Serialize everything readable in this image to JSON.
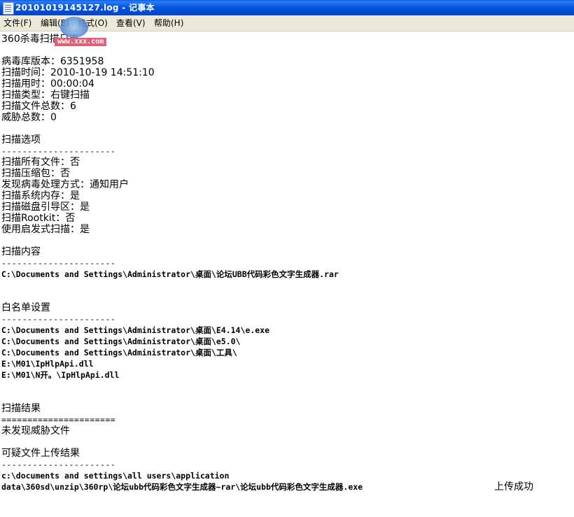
{
  "window": {
    "title": "20101019145127.log - 记事本",
    "icon": "notepad-icon"
  },
  "menu": [
    {
      "label": "文件(F)"
    },
    {
      "label": "编辑(E)"
    },
    {
      "label": "格式(O)"
    },
    {
      "label": "查看(V)"
    },
    {
      "label": "帮助(H)"
    }
  ],
  "watermark": {
    "text": "www.xxx.com"
  },
  "log": {
    "header": "360杀毒扫描日志",
    "summary": [
      "病毒库版本：6351958",
      "扫描时间：2010-10-19 14:51:10",
      "扫描用时：00:00:04",
      "扫描类型：右键扫描",
      "扫描文件总数：6",
      "威胁总数：0"
    ],
    "options_heading": "扫描选项",
    "dash_line": "----------------------",
    "options": [
      "扫描所有文件：否",
      "扫描压缩包：否",
      "发现病毒处理方式：通知用户",
      "扫描系统内存：是",
      "扫描磁盘引导区：是",
      "扫描Rootkit：否",
      "使用启发式扫描：是"
    ],
    "content_heading": "扫描内容",
    "content": [
      "C:\\Documents and Settings\\Administrator\\桌面\\论坛UBB代码彩色文字生成器.rar"
    ],
    "whitelist_heading": "白名单设置",
    "whitelist": [
      "C:\\Documents and Settings\\Administrator\\桌面\\E4.14\\e.exe",
      "C:\\Documents and Settings\\Administrator\\桌面\\e5.0\\",
      "C:\\Documents and Settings\\Administrator\\桌面\\工具\\",
      "E:\\M01\\IpHlpApi.dll",
      "E:\\M01\\N开。\\IpHlpApi.dll"
    ],
    "result_heading": "扫描结果",
    "eq_line": "======================",
    "result": "未发现威胁文件",
    "upload_heading": "可疑文件上传结果",
    "upload_line1": "c:\\documents and settings\\all users\\application",
    "upload_line2": "data\\360sd\\unzip\\360rp\\论坛ubb代码彩色文字生成器~rar\\论坛ubb代码彩色文字生成器.exe",
    "upload_status": "上传成功"
  }
}
